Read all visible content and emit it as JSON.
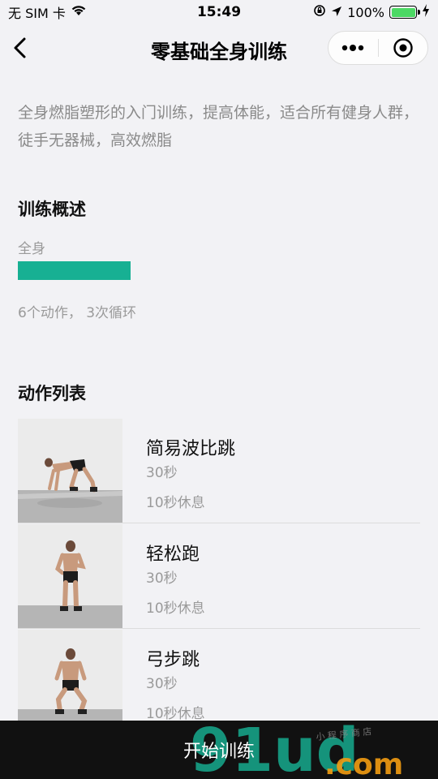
{
  "status": {
    "carrier": "无 SIM 卡",
    "time": "15:49",
    "battery": "100%",
    "battery_level": 1.0,
    "icons": [
      "wifi-icon",
      "orientation-lock-icon",
      "location-icon",
      "battery-icon",
      "charging-icon"
    ]
  },
  "nav": {
    "title": "零基础全身训练",
    "icons": [
      "back-icon",
      "more-icon",
      "close-target-icon"
    ]
  },
  "description": "全身燃脂塑形的入门训练，提高体能，适合所有健身人群，徒手无器械，高效燃脂",
  "overview": {
    "title": "训练概述",
    "body_part": "全身",
    "counts": "6个动作， 3次循环",
    "accent_color": "#17b093"
  },
  "exercises": {
    "title": "动作列表",
    "items": [
      {
        "name": "简易波比跳",
        "duration": "30秒",
        "rest": "10秒休息"
      },
      {
        "name": "轻松跑",
        "duration": "30秒",
        "rest": "10秒休息"
      },
      {
        "name": "弓步跳",
        "duration": "30秒",
        "rest": "10秒休息"
      }
    ]
  },
  "bottom": {
    "start_label": "开始训练",
    "watermark": "91ud.com",
    "watermark_sub": "小 程 序 商 店"
  }
}
